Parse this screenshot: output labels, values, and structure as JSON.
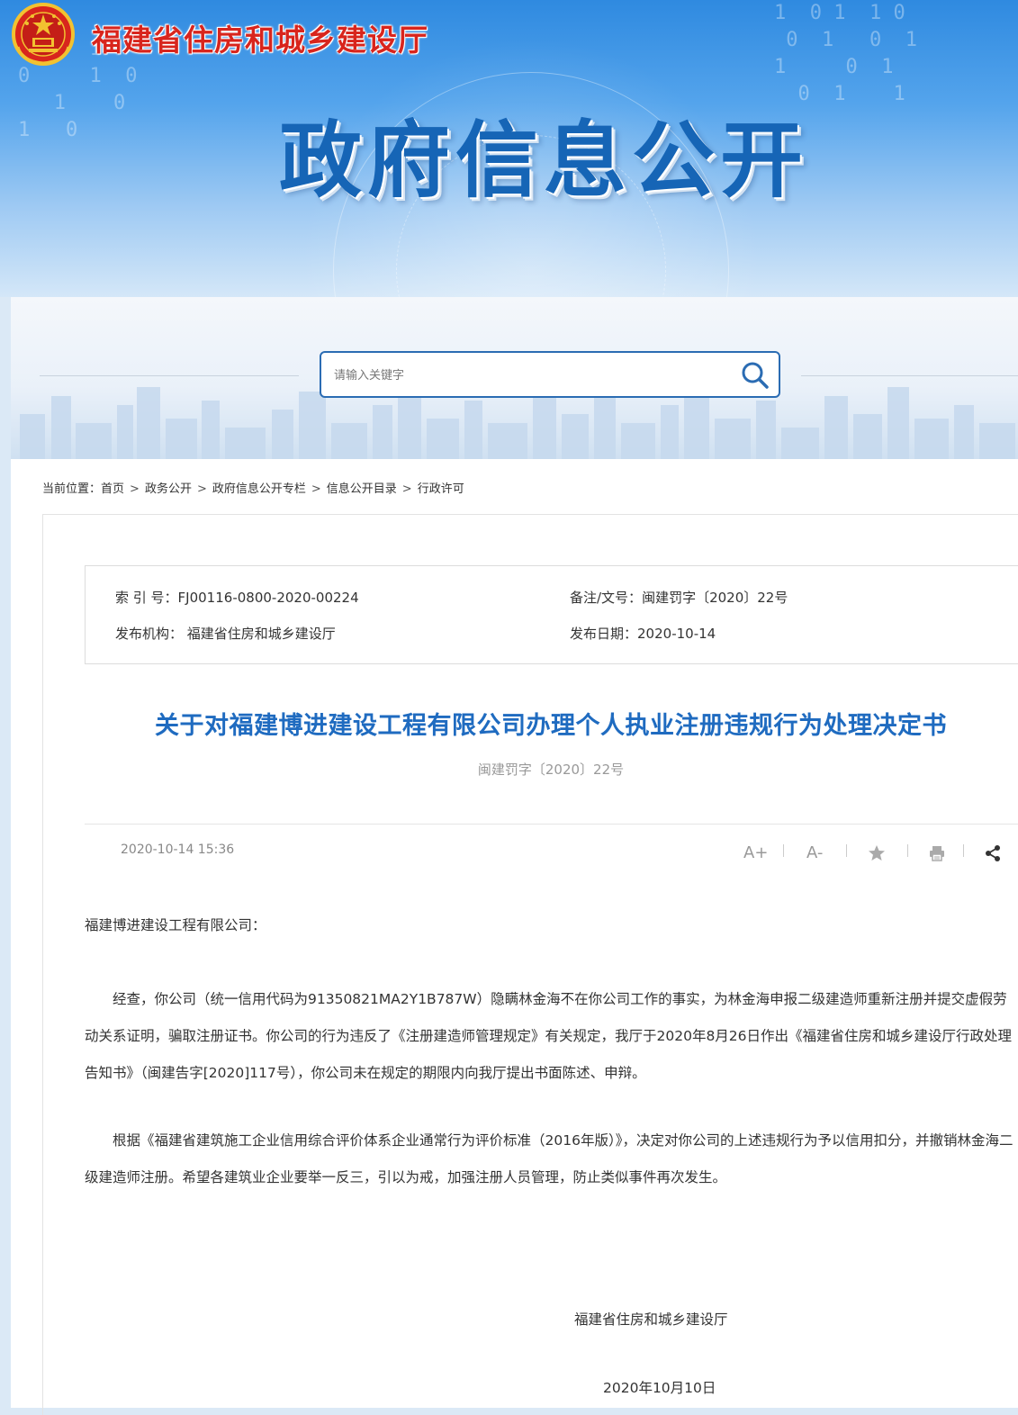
{
  "site": {
    "name": "福建省住房和城乡建设厅",
    "banner_title": "政府信息公开",
    "emblem": "national-emblem-icon"
  },
  "search": {
    "placeholder": "请输入关键字",
    "icon": "search-icon"
  },
  "breadcrumb": {
    "prefix": "当前位置：",
    "items": [
      "首页",
      "政务公开",
      "政府信息公开专栏",
      "信息公开目录",
      "行政许可"
    ],
    "separator": ">"
  },
  "meta": {
    "index_label": "索 引 号：",
    "index_value": "FJ00116-0800-2020-00224",
    "docno_label": "备注/文号：",
    "docno_value": "闽建罚字〔2020〕22号",
    "org_label": "发布机构：",
    "org_value": "福建省住房和城乡建设厅",
    "date_label": "发布日期：",
    "date_value": "2020-10-14"
  },
  "article": {
    "title": "关于对福建博进建设工程有限公司办理个人执业注册违规行为处理决定书",
    "subtitle": "闽建罚字〔2020〕22号",
    "publish_time": "2020-10-14 15:36",
    "tools": {
      "font_increase": "A+",
      "font_decrease": "A-",
      "favorite_icon": "star-icon",
      "print_icon": "printer-icon",
      "share_icon": "share-icon"
    },
    "salutation": "福建博进建设工程有限公司：",
    "paragraph1": "经查，你公司（统一信用代码为91350821MA2Y1B787W）隐瞒林金海不在你公司工作的事实，为林金海申报二级建造师重新注册并提交虚假劳动关系证明，骗取注册证书。你公司的行为违反了《注册建造师管理规定》有关规定，我厅于2020年8月26日作出《福建省住房和城乡建设厅行政处理告知书》（闽建告字[2020]117号），你公司未在规定的期限内向我厅提出书面陈述、申辩。",
    "paragraph2": "根据《福建省建筑施工企业信用综合评价体系企业通常行为评价标准（2016年版）》，决定对你公司的上述违规行为予以信用扣分，并撤销林金海二级建造师注册。希望各建筑业企业要举一反三，引以为戒，加强注册人员管理，防止类似事件再次发生。",
    "sign_org": "福建省住房和城乡建设厅",
    "sign_date": "2020年10月10日"
  },
  "colors": {
    "brand_red": "#d8251d",
    "title_blue": "#1f6bc0",
    "banner_blue": "#1665b6",
    "search_border": "#2b6cb3"
  }
}
